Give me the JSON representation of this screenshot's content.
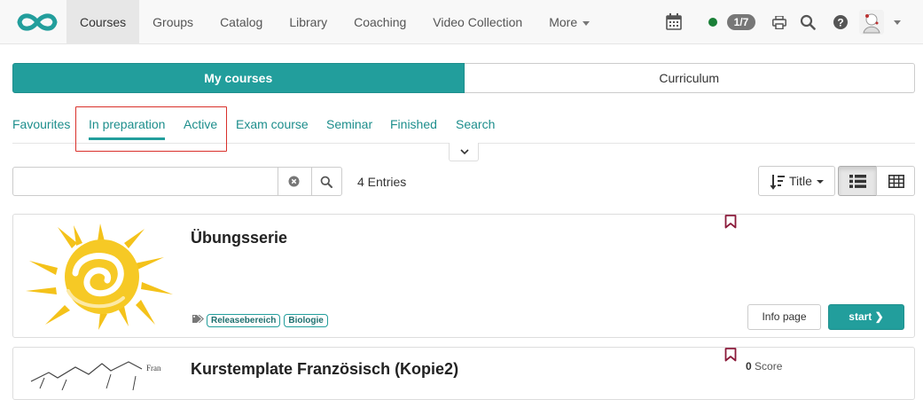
{
  "nav": {
    "items": [
      {
        "label": "Courses",
        "active": true
      },
      {
        "label": "Groups"
      },
      {
        "label": "Catalog"
      },
      {
        "label": "Library"
      },
      {
        "label": "Coaching"
      },
      {
        "label": "Video Collection"
      },
      {
        "label": "More"
      }
    ],
    "badge": "1/7",
    "status_color": "#1a7f37"
  },
  "segment": {
    "my_courses": "My courses",
    "curriculum": "Curriculum"
  },
  "tabs": [
    "Favourites",
    "In preparation",
    "Active",
    "Exam course",
    "Seminar",
    "Finished",
    "Search"
  ],
  "selected_tab": "In preparation",
  "search": {
    "value": "",
    "placeholder": ""
  },
  "entries": "4 Entries",
  "sort": {
    "label": "Title"
  },
  "courses": [
    {
      "title": "Übungsserie",
      "tags": [
        "Releasebereich",
        "Biologie"
      ],
      "info_label": "Info page",
      "start_label": "start"
    },
    {
      "title": "Kurstemplate Französisch (Kopie2)",
      "score_value": "0",
      "score_label": "Score"
    }
  ],
  "colors": {
    "accent": "#229e9c",
    "highlight": "#d9302a",
    "bookmark": "#8b1a3a"
  }
}
